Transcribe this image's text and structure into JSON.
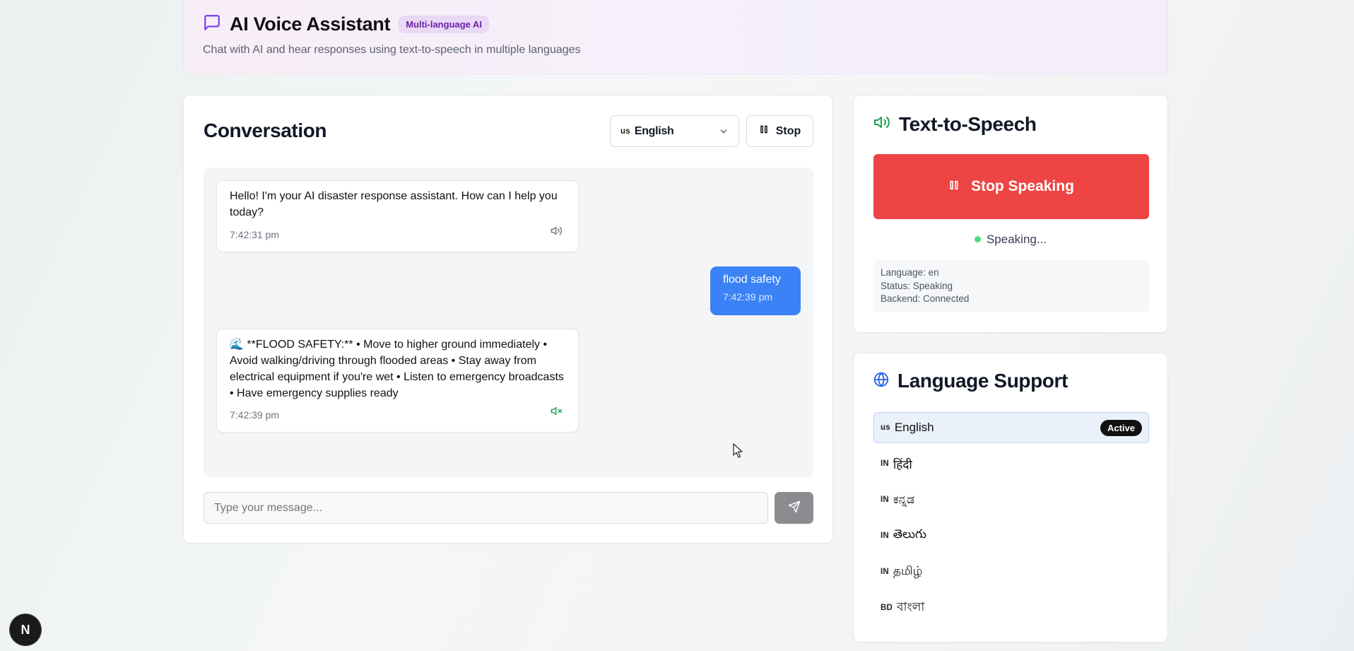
{
  "header": {
    "title": "AI Voice Assistant",
    "badge": "Multi-language AI",
    "subtitle": "Chat with AI and hear responses using text-to-speech in multiple languages",
    "icon": "chat-bubble-icon"
  },
  "conversation": {
    "title": "Conversation",
    "language_select": {
      "flag": "us",
      "value": "English"
    },
    "stop_label": "Stop",
    "messages": [
      {
        "role": "assistant",
        "text": "Hello! I'm your AI disaster response assistant. How can I help you today?",
        "time": "7:42:31 pm",
        "icon": "speaker-icon"
      },
      {
        "role": "user",
        "text": "flood safety",
        "time": "7:42:39 pm"
      },
      {
        "role": "assistant",
        "text": "🌊 **FLOOD SAFETY:** • Move to higher ground immediately • Avoid walking/driving through flooded areas • Stay away from electrical equipment if you're wet • Listen to emergency broadcasts • Have emergency supplies ready",
        "time": "7:42:39 pm",
        "icon": "speaker-mute-icon"
      }
    ],
    "input_placeholder": "Type your message..."
  },
  "tts": {
    "title": "Text-to-Speech",
    "button_label": "Stop Speaking",
    "status_text": "Speaking...",
    "info": {
      "language": "Language: en",
      "status": "Status: Speaking",
      "backend": "Backend: Connected"
    }
  },
  "languages": {
    "title": "Language Support",
    "active_label": "Active",
    "items": [
      {
        "flag": "us",
        "name": "English",
        "active": true
      },
      {
        "flag": "IN",
        "name": "हिंदी",
        "active": false
      },
      {
        "flag": "IN",
        "name": "ಕನ್ನಡ",
        "active": false
      },
      {
        "flag": "IN",
        "name": "తెలుగు",
        "active": false
      },
      {
        "flag": "IN",
        "name": "தமிழ்",
        "active": false
      },
      {
        "flag": "BD",
        "name": "বাংলা",
        "active": false
      }
    ]
  },
  "footer": {
    "logo_letter": "N"
  },
  "colors": {
    "accent": "#3b82f6",
    "danger": "#ef4444",
    "badge_bg": "#ead9f5",
    "badge_text": "#6b21a8",
    "success": "#4ade80"
  }
}
